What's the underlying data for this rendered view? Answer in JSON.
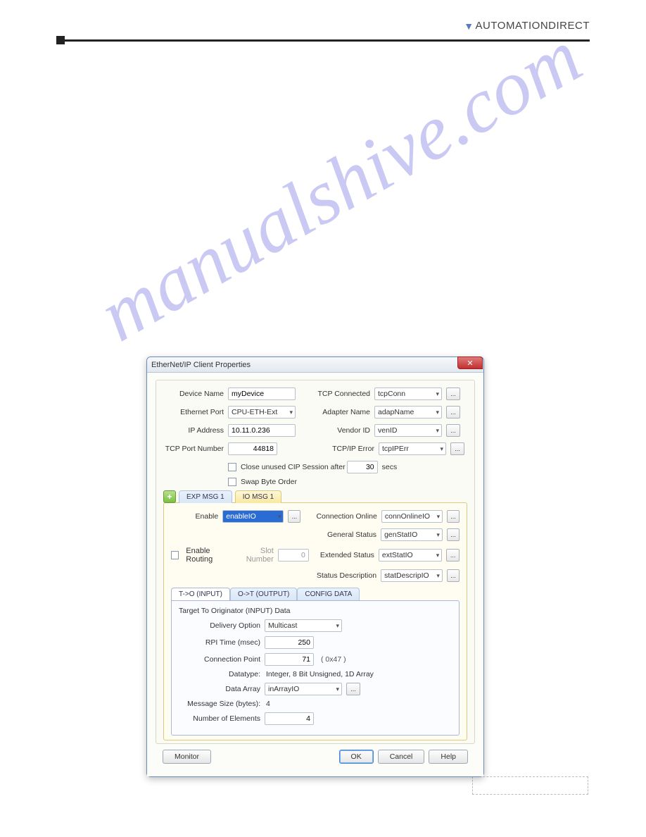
{
  "brand": "AUTOMATIONDIRECT",
  "watermark": "manualshive.com",
  "dialog": {
    "title": "EtherNet/IP Client Properties",
    "close_x": "✕",
    "left": {
      "device_name_label": "Device Name",
      "device_name_value": "myDevice",
      "ethernet_port_label": "Ethernet Port",
      "ethernet_port_value": "CPU-ETH-Ext",
      "ip_address_label": "IP Address",
      "ip_address_value": "10.11.0.236",
      "tcp_port_label": "TCP Port Number",
      "tcp_port_value": "44818",
      "close_session_label": "Close unused CIP Session after",
      "close_session_value": "30",
      "secs": "secs",
      "swap_label": "Swap Byte Order"
    },
    "right": {
      "tcp_connected_label": "TCP Connected",
      "tcp_connected_value": "tcpConn",
      "adapter_name_label": "Adapter Name",
      "adapter_name_value": "adapName",
      "vendor_id_label": "Vendor ID",
      "vendor_id_value": "venID",
      "tcp_error_label": "TCP/IP Error",
      "tcp_error_value": "tcpIPErr"
    },
    "browse_label": "...",
    "tabs": {
      "add": "+",
      "tab1": "EXP MSG 1",
      "tab2": "IO MSG 1"
    },
    "io_msg": {
      "enable_label": "Enable",
      "enable_value": "enableIO",
      "conn_online_label": "Connection Online",
      "conn_online_value": "connOnlineIO",
      "gen_status_label": "General Status",
      "gen_status_value": "genStatIO",
      "enable_routing_label": "Enable Routing",
      "slot_label": "Slot Number",
      "slot_value": "0",
      "ext_status_label": "Extended Status",
      "ext_status_value": "extStatIO",
      "status_desc_label": "Status Description",
      "status_desc_value": "statDescripIO"
    },
    "subtabs": {
      "t_o": "T->O (INPUT)",
      "o_t": "O->T (OUTPUT)",
      "config": "CONFIG DATA"
    },
    "input_panel": {
      "section": "Target To Originator (INPUT) Data",
      "delivery_label": "Delivery Option",
      "delivery_value": "Multicast",
      "rpi_label": "RPI Time (msec)",
      "rpi_value": "250",
      "conn_point_label": "Connection Point",
      "conn_point_value": "71",
      "conn_point_hex": "( 0x47 )",
      "datatype_label": "Datatype:",
      "datatype_value": "Integer, 8 Bit Unsigned, 1D Array",
      "data_array_label": "Data Array",
      "data_array_value": "inArrayIO",
      "msg_size_label": "Message Size (bytes):",
      "msg_size_value": "4",
      "num_elem_label": "Number of Elements",
      "num_elem_value": "4"
    },
    "buttons": {
      "monitor": "Monitor",
      "ok": "OK",
      "cancel": "Cancel",
      "help": "Help"
    }
  }
}
